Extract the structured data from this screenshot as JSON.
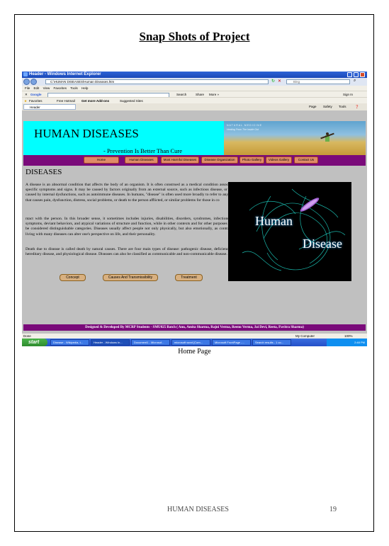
{
  "document": {
    "heading": "Snap Shots of Project",
    "caption": "Home Page",
    "footer_title": "HUMAN DISEASES",
    "page_number": "19"
  },
  "browser": {
    "window_title": "Header - Windows Internet Explorer",
    "address": "C:\\HUMAN DISEASES\\Human Diseases.htm",
    "search_placeholder": "Bing",
    "menu": [
      "File",
      "Edit",
      "View",
      "Favorites",
      "Tools",
      "Help"
    ],
    "toolbar": {
      "google": "Google",
      "search": "Search",
      "share": "Share",
      "more": "More »",
      "sign_in": "Sign In"
    },
    "favorites": {
      "label": "Favorites",
      "items": [
        "Free Hotmail",
        "Get more Add-ons",
        "Suggested Sites"
      ]
    },
    "tab_label": "Header",
    "command_bar": [
      "Page",
      "Safety",
      "Tools"
    ],
    "status_left": "Done",
    "status_zone": "My Computer",
    "zoom": "100%"
  },
  "site": {
    "title": "HUMAN DISEASES",
    "tagline": "- Prevention Is Better Than Cure",
    "banner_text_1": "NATURAL MEDICINE",
    "banner_text_2": "Healing From The Inside Out",
    "nav": [
      "Home",
      "Human Diseases",
      "Most Harmful Diseases",
      "Disease Organization",
      "Photo Gallery",
      "Videos Gallery",
      "Contact Us"
    ],
    "section_heading": "DISEASES",
    "para1": "A disease is an abnormal condition that affects the body of an organism. It is often construed as a medical condition associated with specific symptoms and signs. It may be caused by factors originally from an external source, such as infectious disease, or it may be caused by internal dysfunctions, such as autoimmune diseases. In humans, \"disease\" is often used more broadly to refer to any condition that causes pain, dysfunction, distress, social problems, or death to the person afflicted, or similar problems for those in co",
    "para2": "ntact with the person. In this broader sense, it sometimes includes injuries, disabilities, disorders, syndromes, infections, isolated symptoms, deviant behaviors, and atypical variations of structure and function, while in other contexts and for other purposes these may be considered distinguishable categories. Diseases usually affect people not only physically, but also emotionally, as contracting and living with many diseases can alter one's perspective on life, and their personality.",
    "para3": "Death due to disease is called death by natural causes. There are four main types of disease: pathogenic disease, deficiency disease, hereditary disease, and physiological disease. Diseases can also be classified as communicable and non-communicable disease.",
    "image_text_1": "Human",
    "image_text_2": "Disease",
    "buttons": [
      "Concept",
      "Causes And Transmissibility",
      "Treatment"
    ],
    "footer": "Designed & Developed By MCRP Students - SMU025 Batch ( Anu, Amita Sharma, Rajni Verma, Reenu Verma, Jai Devi, Reeta, Pavitra Sharma)"
  },
  "taskbar": {
    "start": "start",
    "items": [
      "Disease - Wikipedia, t...",
      "Header - Windows In...",
      "Document1 - Microsof...",
      "microsoft word [Com...",
      "Microsoft FrontPage -...",
      "Search results - 1 co..."
    ],
    "clock": "2:48 PM"
  },
  "colors": {
    "banner_cyan": "#00ffff",
    "nav_purple": "#7a0a7a",
    "nav_button": "#e08a68",
    "content_gray": "#c0c0c0",
    "xp_blue": "#2450c8"
  }
}
